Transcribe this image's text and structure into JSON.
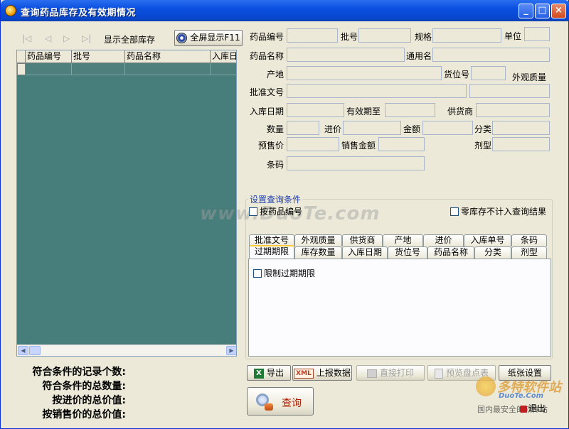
{
  "window": {
    "title": "查询药品库存及有效期情况",
    "min": "_",
    "max": "□",
    "close": "×"
  },
  "toolbar": {
    "nav_first": "|◁",
    "nav_prev": "◁",
    "nav_next": "▷",
    "nav_last": "▷|",
    "show_all": "显示全部库存",
    "fullscreen": "全屏显示F11"
  },
  "grid": {
    "columns": [
      "药品编号",
      "批号",
      "药品名称",
      "入库日"
    ]
  },
  "summary": {
    "record_count": "符合条件的记录个数:",
    "total_qty": "符合条件的总数量:",
    "total_cost": "按进价的总价值:",
    "total_sale": "按销售价的总价值:"
  },
  "form": {
    "drug_code": "药品编号",
    "batch": "批号",
    "spec": "规格",
    "unit": "单位",
    "drug_name": "药品名称",
    "common_name": "通用名",
    "origin": "产地",
    "location": "货位号",
    "appearance": "外观质量",
    "approval": "批准文号",
    "in_date": "入库日期",
    "expire": "有效期至",
    "supplier": "供货商",
    "qty": "数量",
    "cost": "进价",
    "amount": "金额",
    "category": "分类",
    "presale": "预售价",
    "sale_amount": "销售金额",
    "dosage": "剂型",
    "barcode": "条码"
  },
  "watermark": "www.DuoTe.com",
  "query_conditions": {
    "title": "设置查询条件",
    "by_code": "按药品编号",
    "zero_stock": "零库存不计入查询结果",
    "tabs_row1": [
      "批准文号",
      "外观质量",
      "供货商",
      "产地",
      "进价",
      "入库单号",
      "条码"
    ],
    "tabs_row2": [
      "过期期限",
      "库存数量",
      "入库日期",
      "货位号",
      "药品名称",
      "分类",
      "剂型"
    ],
    "limit_expiry": "限制过期期限"
  },
  "actions": {
    "export": "导出",
    "xml_icon": "XML",
    "report": "上报数据",
    "print": "直接打印",
    "preview": "预览盘点表",
    "paper": "纸张设置",
    "query": "查询",
    "exit": "退出"
  },
  "logo": {
    "main": "多特软件站",
    "mid": "DuoTe.Com",
    "sub": "国内最安全的软件站"
  }
}
